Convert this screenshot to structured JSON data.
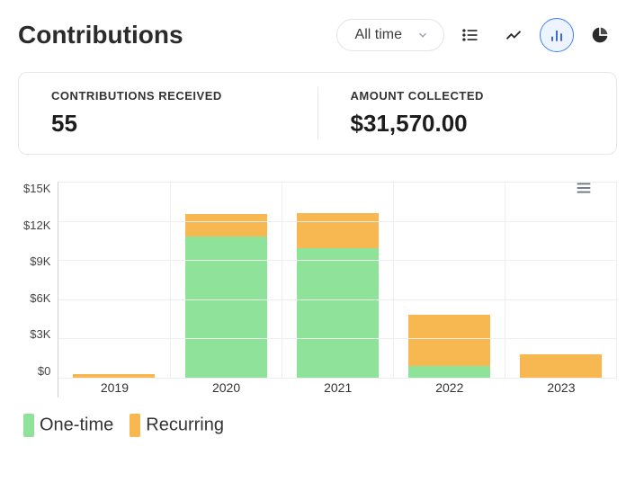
{
  "header": {
    "title": "Contributions",
    "time_range": "All time"
  },
  "stats": {
    "received_label": "CONTRIBUTIONS RECEIVED",
    "received_value": "55",
    "collected_label": "AMOUNT COLLECTED",
    "collected_value": "$31,570.00"
  },
  "legend": {
    "one_time": "One-time",
    "recurring": "Recurring"
  },
  "colors": {
    "one_time": "#8FE29A",
    "recurring": "#F7B851",
    "active_ring": "#3b82f6"
  },
  "chart_data": {
    "type": "bar",
    "title": "",
    "xlabel": "",
    "ylabel": "",
    "ylim": [
      0,
      15000
    ],
    "y_ticks": [
      "$15K",
      "$12K",
      "$9K",
      "$6K",
      "$3K",
      "$0"
    ],
    "categories": [
      "2019",
      "2020",
      "2021",
      "2022",
      "2023"
    ],
    "series": [
      {
        "name": "One-time",
        "values": [
          0,
          10800,
          9900,
          900,
          0
        ]
      },
      {
        "name": "Recurring",
        "values": [
          300,
          1700,
          2700,
          3900,
          1800
        ]
      }
    ],
    "stacked": true,
    "legend_position": "bottom"
  }
}
